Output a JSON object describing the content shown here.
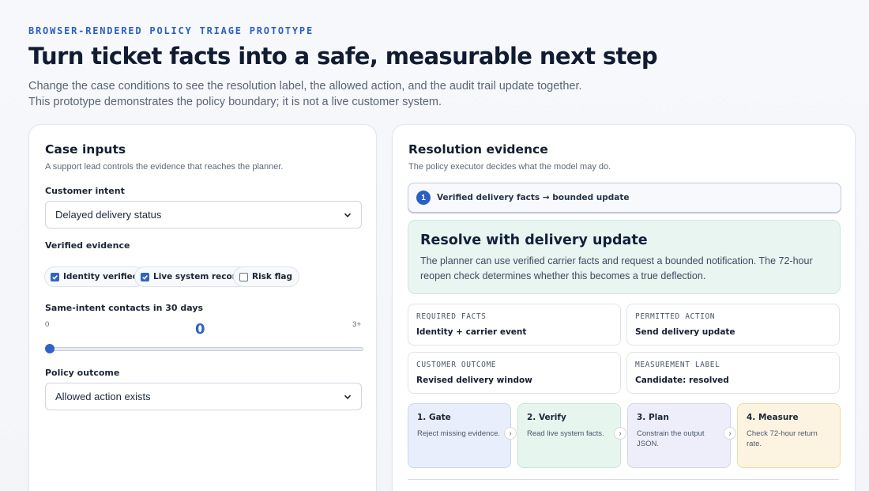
{
  "header": {
    "eyebrow": "BROWSER-RENDERED POLICY TRIAGE PROTOTYPE",
    "title": "Turn ticket facts into a safe, measurable next step",
    "subtitle_line1": "Change the case conditions to see the resolution label, the allowed action, and the audit trail update together.",
    "subtitle_line2": "This prototype demonstrates the policy boundary; it is not a live customer system."
  },
  "inputs": {
    "title": "Case inputs",
    "description": "A support lead controls the evidence that reaches the planner.",
    "intent_label": "Customer intent",
    "intent_value": "Delayed delivery status",
    "evidence_label": "Verified evidence",
    "evidence": [
      {
        "label": "Identity verified",
        "checked": true
      },
      {
        "label": "Live system record",
        "checked": true
      },
      {
        "label": "Risk flag",
        "checked": false
      }
    ],
    "contacts_label": "Same-intent contacts in 30 days",
    "contacts_min": "0",
    "contacts_max": "3+",
    "contacts_value": "0",
    "outcome_label": "Policy outcome",
    "outcome_value": "Allowed action exists"
  },
  "evidence": {
    "title": "Resolution evidence",
    "description": "The policy executor decides what the model may do.",
    "step_number": "1",
    "step_text": "Verified delivery facts → bounded update",
    "result_title": "Resolve with delivery update",
    "result_desc": "The planner can use verified carrier facts and request a bounded notification. The 72-hour reopen check determines whether this becomes a true deflection.",
    "facts": [
      {
        "label": "REQUIRED FACTS",
        "value": "Identity + carrier event"
      },
      {
        "label": "PERMITTED ACTION",
        "value": "Send delivery update"
      },
      {
        "label": "CUSTOMER OUTCOME",
        "value": "Revised delivery window"
      },
      {
        "label": "MEASUREMENT LABEL",
        "value": "Candidate: resolved"
      }
    ],
    "flow": [
      {
        "title": "1. Gate",
        "desc": "Reject missing evidence.",
        "bg": "#e8eefb",
        "border": "#c9d6f1"
      },
      {
        "title": "2. Verify",
        "desc": "Read live system facts.",
        "bg": "#e7f5ef",
        "border": "#c7e6d9"
      },
      {
        "title": "3. Plan",
        "desc": "Constrain the output JSON.",
        "bg": "#eeeefb",
        "border": "#d4d4f0"
      },
      {
        "title": "4. Measure",
        "desc": "Check 72-hour return rate.",
        "bg": "#fdf3e1",
        "border": "#f1d9a8"
      }
    ],
    "arrow_glyph": "›"
  },
  "colors": {
    "accent": "#2f62c9",
    "result_bg": "#e9f5f1"
  }
}
